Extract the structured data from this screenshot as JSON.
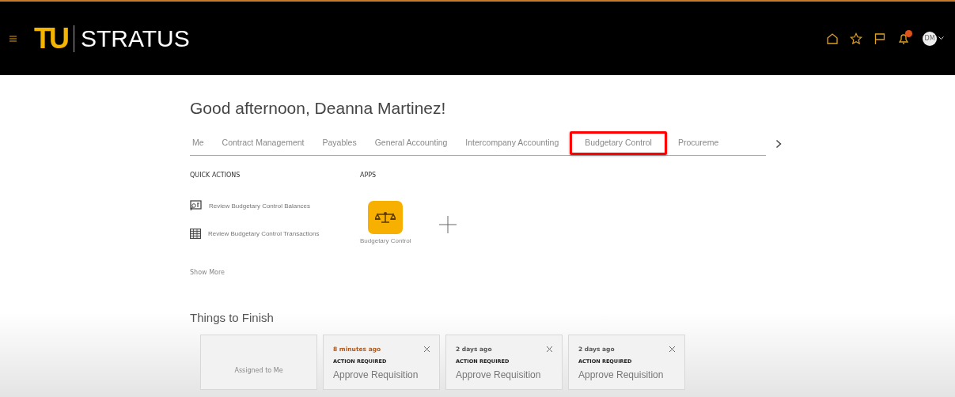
{
  "header": {
    "logo_mark": "TU",
    "logo_text": "STRATUS",
    "user_initials": "DM",
    "notification_badge": true
  },
  "greeting": "Good afternoon, Deanna Martinez!",
  "tabs": [
    {
      "label": "Me",
      "highlighted": false
    },
    {
      "label": "Contract Management",
      "highlighted": false
    },
    {
      "label": "Payables",
      "highlighted": false
    },
    {
      "label": "General Accounting",
      "highlighted": false
    },
    {
      "label": "Intercompany Accounting",
      "highlighted": false
    },
    {
      "label": "Budgetary Control",
      "highlighted": true
    },
    {
      "label": "Procureme",
      "highlighted": false
    }
  ],
  "quick_actions": {
    "title": "QUICK ACTIONS",
    "items": [
      {
        "label": "Review Budgetary Control Balances",
        "kind": "inquiry"
      },
      {
        "label": "Review Budgetary Control Transactions",
        "kind": "table"
      }
    ],
    "show_more": "Show More"
  },
  "apps": {
    "title": "APPS",
    "items": [
      {
        "label": "Budgetary Control"
      }
    ]
  },
  "things_to_finish": {
    "title": "Things to Finish",
    "summary": "Assigned to Me",
    "cards": [
      {
        "time": "8 minutes ago",
        "recent": true,
        "status": "ACTION REQUIRED",
        "title": "Approve Requisition"
      },
      {
        "time": "2 days ago",
        "recent": false,
        "status": "ACTION REQUIRED",
        "title": "Approve Requisition"
      },
      {
        "time": "2 days ago",
        "recent": false,
        "status": "ACTION REQUIRED",
        "title": "Approve Requisition"
      }
    ]
  }
}
